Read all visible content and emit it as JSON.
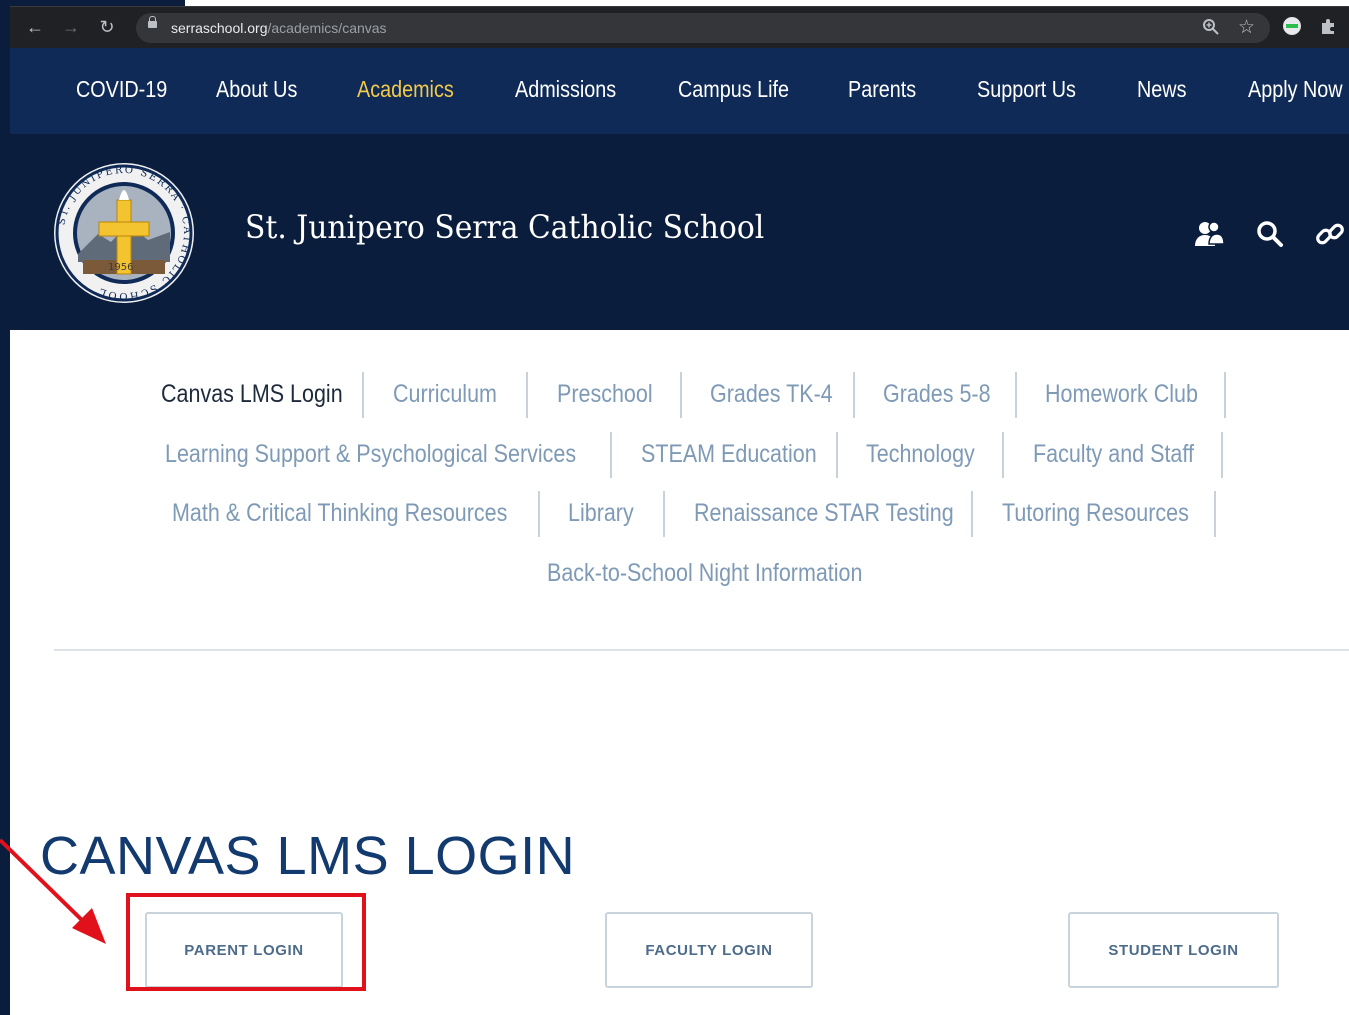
{
  "browser": {
    "url_domain": "serraschool.org",
    "url_path": "/academics/canvas"
  },
  "nav": {
    "items": [
      {
        "label": "COVID-19",
        "active": false
      },
      {
        "label": "About Us",
        "active": false
      },
      {
        "label": "Academics",
        "active": true
      },
      {
        "label": "Admissions",
        "active": false
      },
      {
        "label": "Campus Life",
        "active": false
      },
      {
        "label": "Parents",
        "active": false
      },
      {
        "label": "Support Us",
        "active": false
      },
      {
        "label": "News",
        "active": false
      },
      {
        "label": "Apply Now",
        "active": false
      }
    ]
  },
  "header": {
    "school_name": "St. Junipero Serra Catholic School",
    "logo_text": "ST. JUNIPERO SERRA · CATHOLIC SCHOOL",
    "logo_year": "1956"
  },
  "subnav": {
    "rows": [
      [
        "Canvas LMS Login",
        "Curriculum",
        "Preschool",
        "Grades TK-4",
        "Grades 5-8",
        "Homework Club"
      ],
      [
        "Learning Support & Psychological Services",
        "STEAM Education",
        "Technology",
        "Faculty and Staff"
      ],
      [
        "Math & Critical Thinking Resources",
        "Library",
        "Renaissance STAR Testing",
        "Tutoring Resources"
      ],
      [
        "Back-to-School Night Information"
      ]
    ],
    "current": "Canvas LMS Login"
  },
  "main": {
    "title": "CANVAS LMS LOGIN",
    "buttons": {
      "parent": "PARENT LOGIN",
      "faculty": "FACULTY LOGIN",
      "student": "STUDENT LOGIN"
    }
  },
  "colors": {
    "nav_bg": "#0f2a56",
    "header_bg": "#0b1d3c",
    "active_nav": "#f3c94b",
    "title": "#133a6e",
    "link": "#7e9ab6",
    "annotation": "#e0111a"
  },
  "icons": [
    "back-arrow-icon",
    "forward-arrow-icon",
    "reload-icon",
    "lock-icon",
    "zoom-icon",
    "star-icon",
    "extension-icon",
    "puzzle-icon",
    "users-icon",
    "search-icon",
    "link-icon"
  ]
}
